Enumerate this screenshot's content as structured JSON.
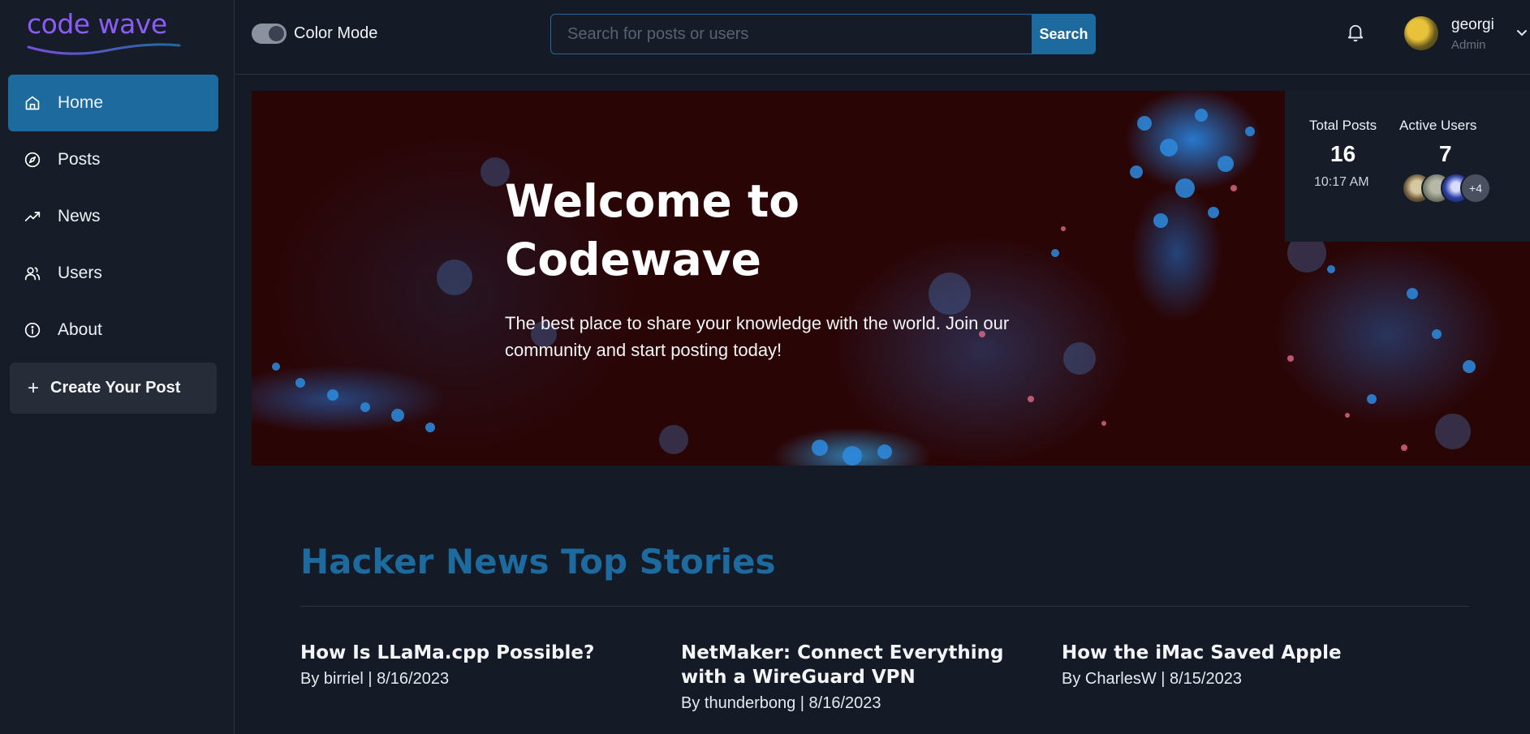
{
  "app": {
    "logo_text": "code wave",
    "brand_color": "#8b5cf6",
    "accent_color": "#1d6a9e"
  },
  "sidebar": {
    "items": [
      {
        "label": "Home",
        "icon": "home-icon",
        "active": true
      },
      {
        "label": "Posts",
        "icon": "compass-icon",
        "active": false
      },
      {
        "label": "News",
        "icon": "trending-up-icon",
        "active": false
      },
      {
        "label": "Users",
        "icon": "users-icon",
        "active": false
      },
      {
        "label": "About",
        "icon": "info-icon",
        "active": false
      }
    ],
    "create_label": "Create Your Post"
  },
  "header": {
    "color_mode_label": "Color Mode",
    "search_placeholder": "Search for posts or users",
    "search_button": "Search",
    "user": {
      "name": "georgi",
      "role": "Admin"
    }
  },
  "hero": {
    "title": "Welcome to Codewave",
    "subtitle": "The best place to share your knowledge with the world. Join our community and start posting today!"
  },
  "stats": {
    "total_posts_label": "Total Posts",
    "total_posts": "16",
    "time": "10:17 AM",
    "active_users_label": "Active Users",
    "active_users": "7",
    "more_users": "+4"
  },
  "news": {
    "heading": "Hacker News Top Stories",
    "stories": [
      {
        "title": "How Is LLaMa.cpp Possible?",
        "meta": "By birriel | 8/16/2023"
      },
      {
        "title": "NetMaker: Connect Everything with a WireGuard VPN",
        "meta": "By thunderbong | 8/16/2023"
      },
      {
        "title": "How the iMac Saved Apple",
        "meta": "By CharlesW | 8/15/2023"
      }
    ]
  }
}
